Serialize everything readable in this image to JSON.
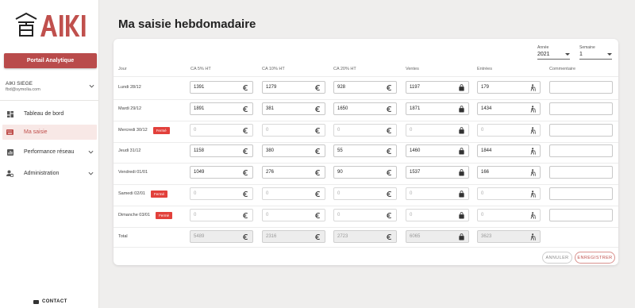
{
  "app": {
    "logo_text": "AIKI"
  },
  "sidebar": {
    "portal_button": "Portail Analytique",
    "user": {
      "name": "AIKI SIEGE",
      "email": "fbd@symolia.com"
    },
    "items": [
      {
        "label": "Tableau de bord",
        "icon": "dashboard-icon"
      },
      {
        "label": "Ma saisie",
        "icon": "keyboard-icon",
        "active": true
      },
      {
        "label": "Performance réseau",
        "icon": "bar-chart-icon"
      },
      {
        "label": "Administration",
        "icon": "admin-settings-icon"
      }
    ],
    "contact": "CONTACT"
  },
  "main": {
    "title": "Ma saisie hebdomadaire",
    "year": {
      "label": "Année",
      "value": "2021"
    },
    "week": {
      "label": "Semaine",
      "value": "1"
    },
    "columns": [
      "Jour",
      "CA 5% HT",
      "CA 10% HT",
      "CA 20% HT",
      "Ventes",
      "Entrées",
      "Commentaire"
    ],
    "closed_label": "Fermé",
    "rows": [
      {
        "day": "Lundi 28/12",
        "closed": false,
        "ca5": "1391",
        "ca10": "1279",
        "ca20": "928",
        "ventes": "1197",
        "entrees": "179",
        "comment": ""
      },
      {
        "day": "Mardi 29/12",
        "closed": false,
        "ca5": "1891",
        "ca10": "381",
        "ca20": "1650",
        "ventes": "1871",
        "entrees": "1434",
        "comment": ""
      },
      {
        "day": "Mercredi 30/12",
        "closed": true,
        "ca5": "0",
        "ca10": "0",
        "ca20": "0",
        "ventes": "0",
        "entrees": "0",
        "comment": ""
      },
      {
        "day": "Jeudi 31/12",
        "closed": false,
        "ca5": "1158",
        "ca10": "380",
        "ca20": "55",
        "ventes": "1460",
        "entrees": "1844",
        "comment": ""
      },
      {
        "day": "Vendredi 01/01",
        "closed": false,
        "ca5": "1049",
        "ca10": "276",
        "ca20": "90",
        "ventes": "1537",
        "entrees": "166",
        "comment": ""
      },
      {
        "day": "Samedi 02/01",
        "closed": true,
        "ca5": "0",
        "ca10": "0",
        "ca20": "0",
        "ventes": "0",
        "entrees": "0",
        "comment": ""
      },
      {
        "day": "Dimanche 03/01",
        "closed": true,
        "ca5": "0",
        "ca10": "0",
        "ca20": "0",
        "ventes": "0",
        "entrees": "0",
        "comment": ""
      }
    ],
    "total": {
      "label": "Total",
      "ca5": "5489",
      "ca10": "2316",
      "ca20": "2723",
      "ventes": "6065",
      "entrees": "3623"
    },
    "buttons": {
      "cancel": "ANNULER",
      "save": "ENREGISTRER"
    }
  },
  "colors": {
    "accent": "#b94b4b",
    "closed_badge": "#e2403b",
    "active_bg": "#f8e8e6"
  }
}
